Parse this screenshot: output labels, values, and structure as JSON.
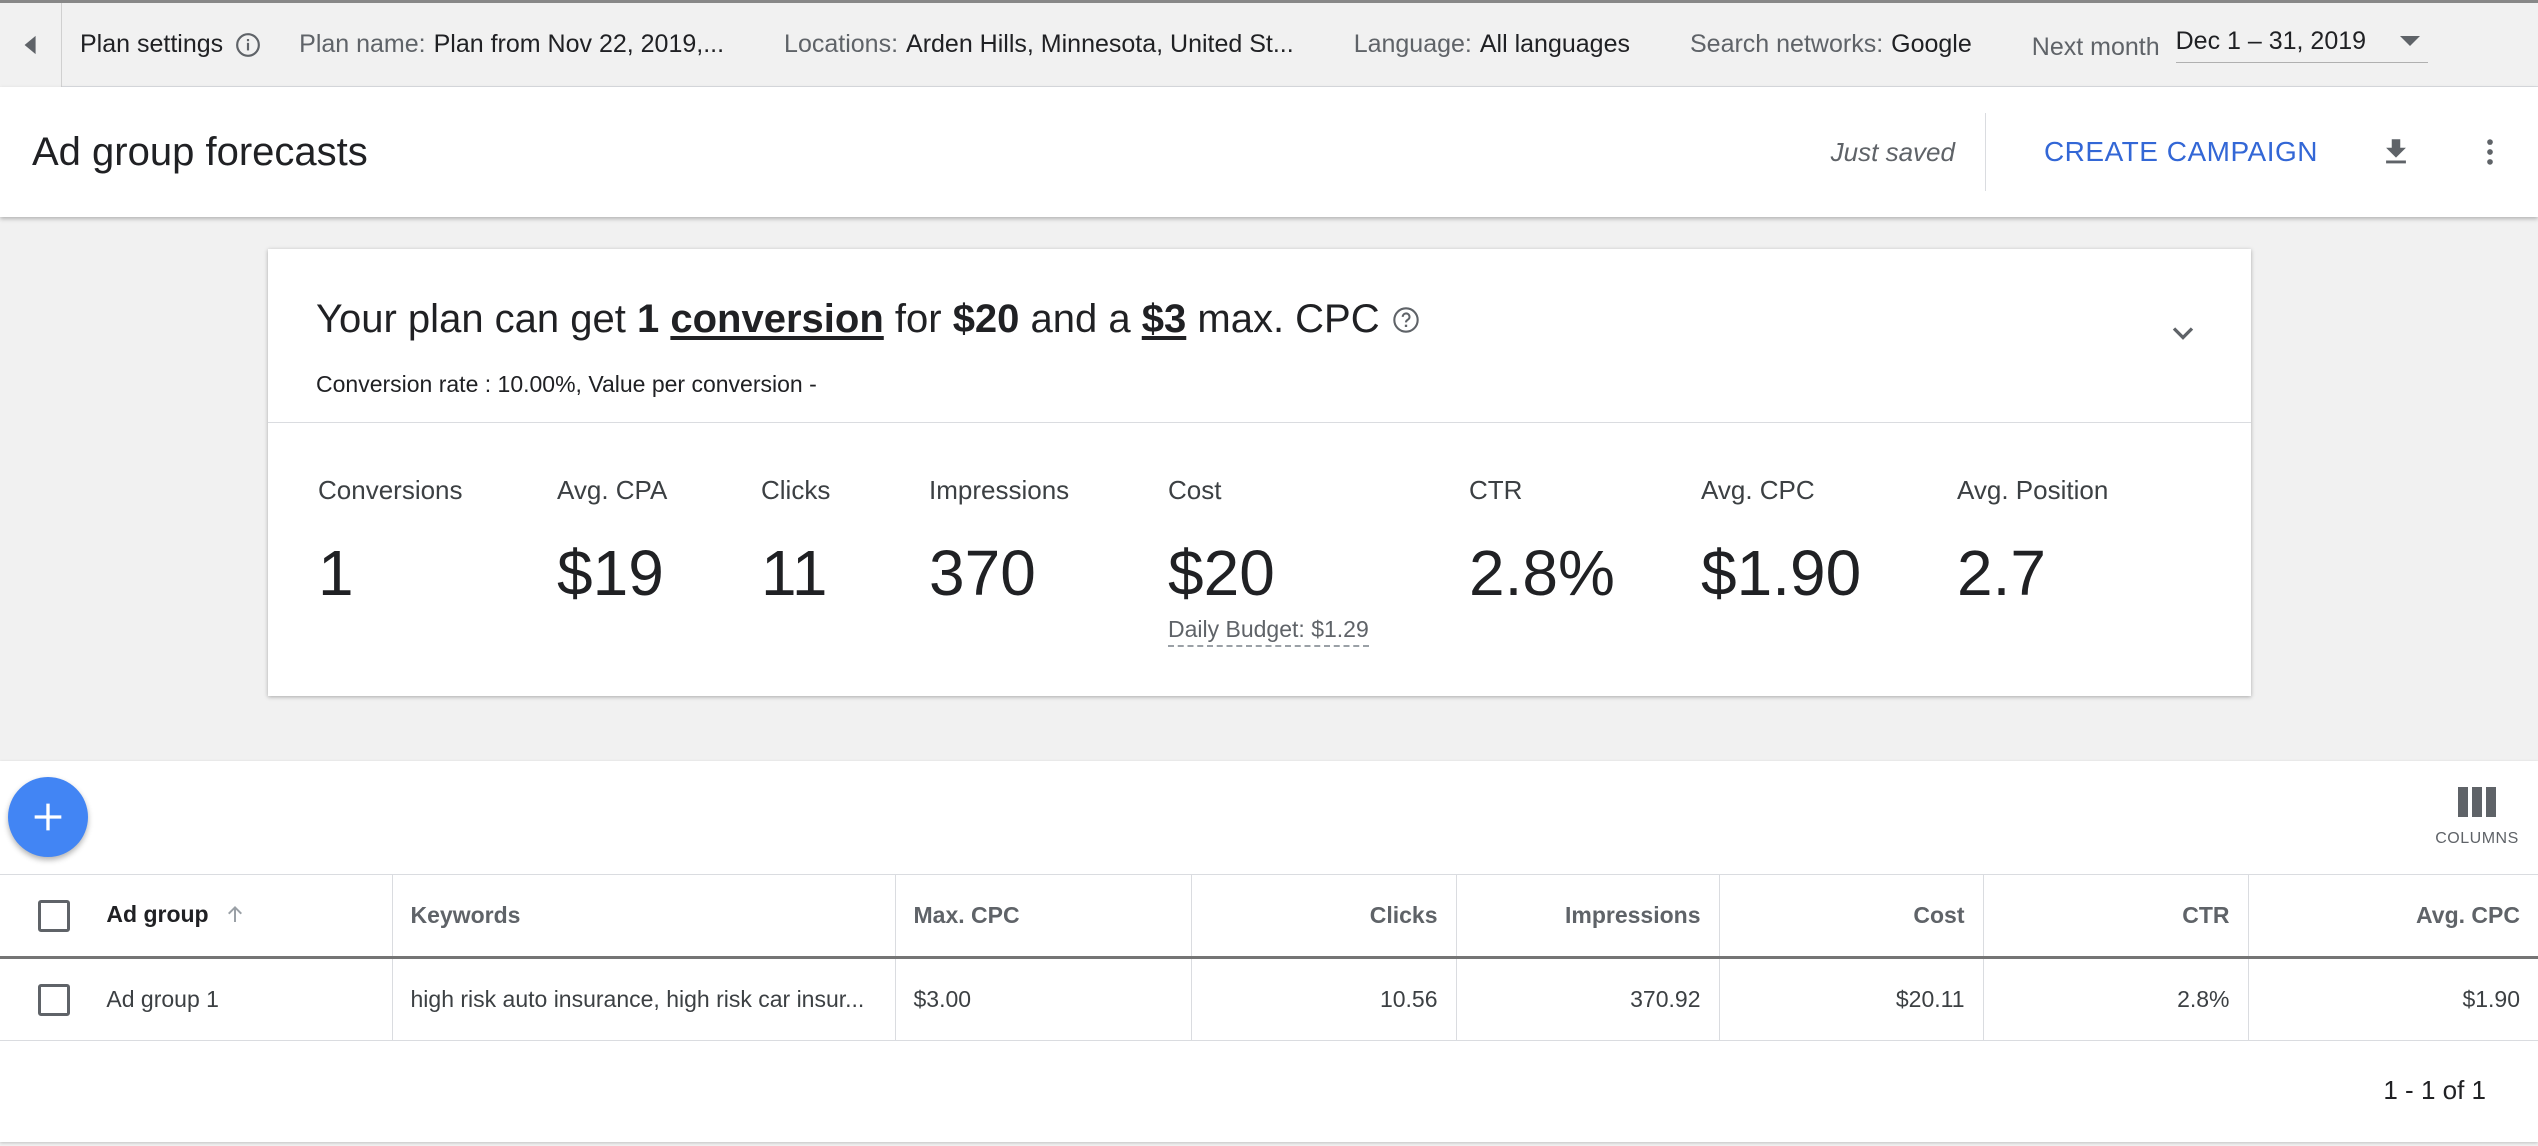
{
  "settings_bar": {
    "plan_settings_label": "Plan settings",
    "plan_name": {
      "label": "Plan name:",
      "value": "Plan from Nov 22, 2019,..."
    },
    "locations": {
      "label": "Locations:",
      "value": "Arden Hills, Minnesota, United St..."
    },
    "language": {
      "label": "Language:",
      "value": "All languages"
    },
    "search_networks": {
      "label": "Search networks:",
      "value": "Google"
    },
    "date_range": {
      "label": "Next month",
      "value": "Dec 1 – 31, 2019"
    }
  },
  "header": {
    "title": "Ad group forecasts",
    "saved_status": "Just saved",
    "create_campaign": "CREATE CAMPAIGN"
  },
  "summary": {
    "prefix": "Your plan can get ",
    "conversions": "1",
    "conversion_word": "conversion",
    "for_text": " for ",
    "cost": "$20",
    "and_text": " and a ",
    "max_cpc": "$3",
    "suffix": " max. CPC",
    "subline": "Conversion rate : 10.00%, Value per conversion -"
  },
  "metrics": [
    {
      "label": "Conversions",
      "value": "1"
    },
    {
      "label": "Avg. CPA",
      "value": "$19"
    },
    {
      "label": "Clicks",
      "value": "11"
    },
    {
      "label": "Impressions",
      "value": "370"
    },
    {
      "label": "Cost",
      "value": "$20"
    },
    {
      "label": "CTR",
      "value": "2.8%"
    },
    {
      "label": "Avg. CPC",
      "value": "$1.90"
    },
    {
      "label": "Avg. Position",
      "value": "2.7"
    }
  ],
  "daily_budget": "Daily Budget: $1.29",
  "toolbar": {
    "columns_label": "COLUMNS"
  },
  "table": {
    "headers": [
      "Ad group",
      "Keywords",
      "Max. CPC",
      "Clicks",
      "Impressions",
      "Cost",
      "CTR",
      "Avg. CPC"
    ],
    "rows": [
      {
        "ad_group": "Ad group 1",
        "keywords": "high risk auto insurance, high risk car insur...",
        "max_cpc": "$3.00",
        "clicks": "10.56",
        "impressions": "370.92",
        "cost": "$20.11",
        "ctr": "2.8%",
        "avg_cpc": "$1.90"
      }
    ]
  },
  "pagination": "1 - 1 of 1",
  "colors": {
    "accent": "#3367d6",
    "fab": "#4285f4"
  }
}
